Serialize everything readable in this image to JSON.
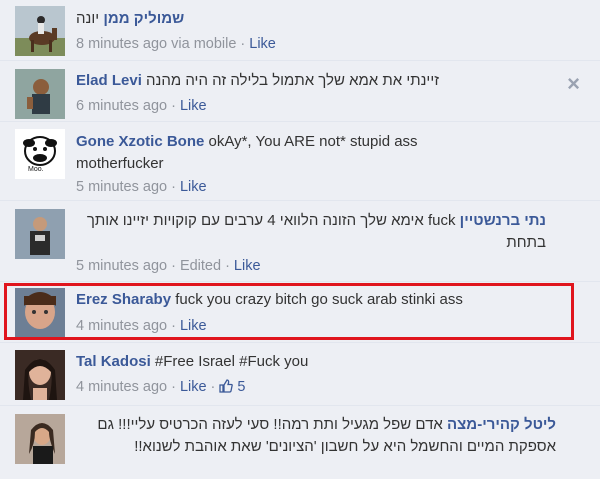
{
  "comments": [
    {
      "name": "שמוליק ממן",
      "text": "יונה",
      "time": "8 minutes ago",
      "via": "via mobile",
      "like": "Like",
      "rtl": true
    },
    {
      "name": "Elad Levi",
      "text": "זיינתי את אמא שלך אתמול בלילה זה היה מהנה",
      "time": "6 minutes ago",
      "like": "Like",
      "rtl": false
    },
    {
      "name": "Gone Xzotic Bone",
      "text": "okAy*, You ARE not* stupid ass motherfucker",
      "time": "5 minutes ago",
      "like": "Like",
      "avatar_caption": "Moo.",
      "rtl": false
    },
    {
      "name": "נתי ברנשטיין",
      "text": "fuck אימא שלך הזונה הלוואי 4 ערבים עם קוקויות יזיינו אותך בתחת",
      "time": "5 minutes ago",
      "edited": "Edited",
      "like": "Like",
      "rtl": true
    },
    {
      "name": "Erez Sharaby",
      "text": "fuck you crazy bitch go suck arab stinki ass",
      "time": "4 minutes ago",
      "like": "Like",
      "rtl": false
    },
    {
      "name": "Tal Kadosi",
      "text": "#Free Israel #Fuck you",
      "time": "4 minutes ago",
      "like": "Like",
      "likes_count": "5",
      "rtl": false
    },
    {
      "name": "ליטל קהירי-מצה",
      "text": "אדם שפל מגעיל ותת רמה!! סעי לעזה הכרטיס עליי!!! גם אספקת המיים והחשמל היא על חשבון 'הציונים' שאת אוהבת לשנוא!!",
      "rtl": true
    }
  ],
  "close_icon": "×",
  "colors": {
    "background": "#edeff4",
    "link": "#3b5998",
    "meta": "#90949c",
    "highlight": "#e0151d"
  }
}
